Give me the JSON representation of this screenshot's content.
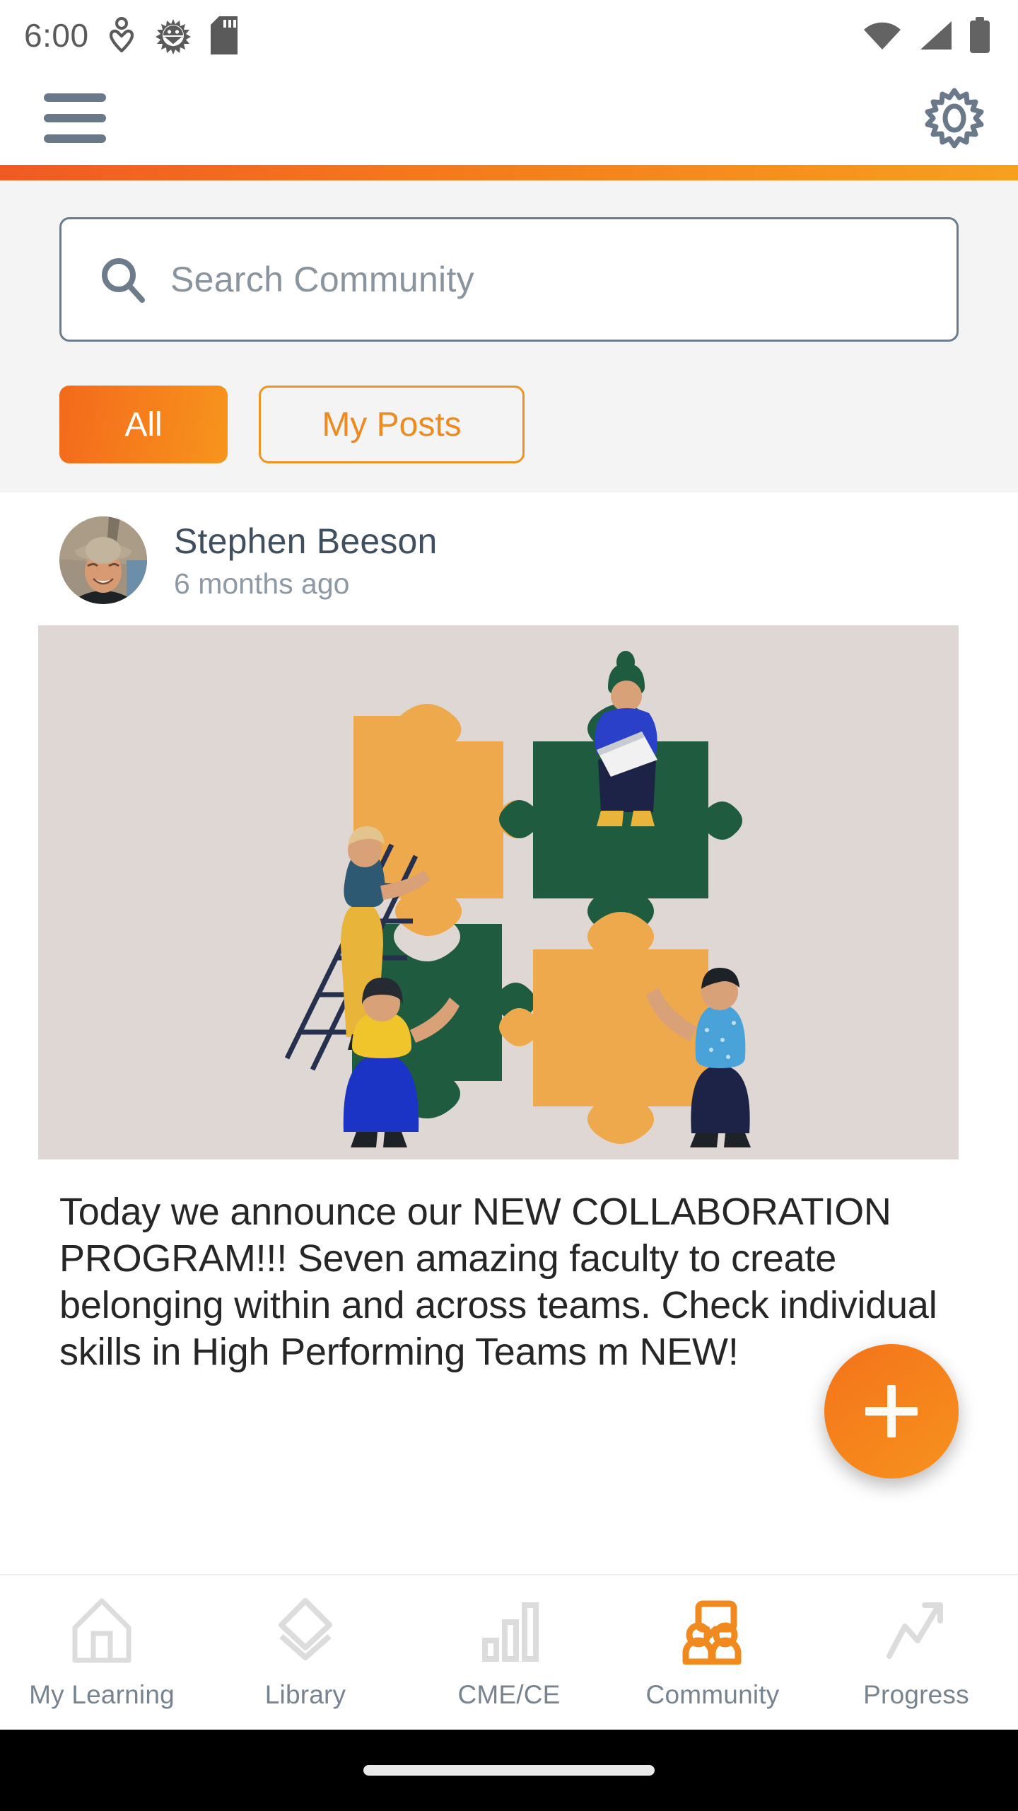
{
  "status_bar": {
    "time": "6:00",
    "left_icons": [
      "location-heart-icon",
      "android-bug-icon",
      "sd-card-icon"
    ],
    "right_icons": [
      "wifi-icon",
      "cellular-signal-icon",
      "battery-icon"
    ]
  },
  "header": {
    "menu_icon": "hamburger-menu-icon",
    "settings_icon": "gear-icon",
    "accent_start": "#F15A22",
    "accent_end": "#F7A01E"
  },
  "search": {
    "placeholder": "Search Community",
    "icon": "search-icon"
  },
  "filters": [
    {
      "label": "All",
      "active": true
    },
    {
      "label": "My Posts",
      "active": false
    }
  ],
  "post": {
    "author": "Stephen Beeson",
    "timestamp": "6 months ago",
    "avatar_alt": "smiling-person-in-wide-brim-hat",
    "image_alt": "four-people-assembling-giant-jigsaw-puzzle",
    "body": "Today we announce our NEW COLLABORATION PROGRAM!!! Seven amazing faculty to create belonging within and across teams. Check individual skills in High Performing Teams m NEW!"
  },
  "fab": {
    "label": "+",
    "icon": "plus-icon"
  },
  "bottom_nav": [
    {
      "label": "My Learning",
      "icon": "home-icon",
      "active": false
    },
    {
      "label": "Library",
      "icon": "layers-icon",
      "active": false
    },
    {
      "label": "CME/CE",
      "icon": "bar-chart-icon",
      "active": false
    },
    {
      "label": "Community",
      "icon": "people-chat-icon",
      "active": true
    },
    {
      "label": "Progress",
      "icon": "trending-up-icon",
      "active": false
    }
  ],
  "colors": {
    "brand_orange": "#F47B1C",
    "brand_orange_dark": "#F15A22",
    "brand_orange_light": "#F7A01E",
    "text_dark": "#262626",
    "text_muted": "#8d99a4",
    "slate": "#69798a",
    "panel_bg": "#F4F4F4",
    "puzzle_tan": "#EDA94B",
    "puzzle_green": "#1F5B3E",
    "illustration_bg": "#DFD7D3"
  }
}
